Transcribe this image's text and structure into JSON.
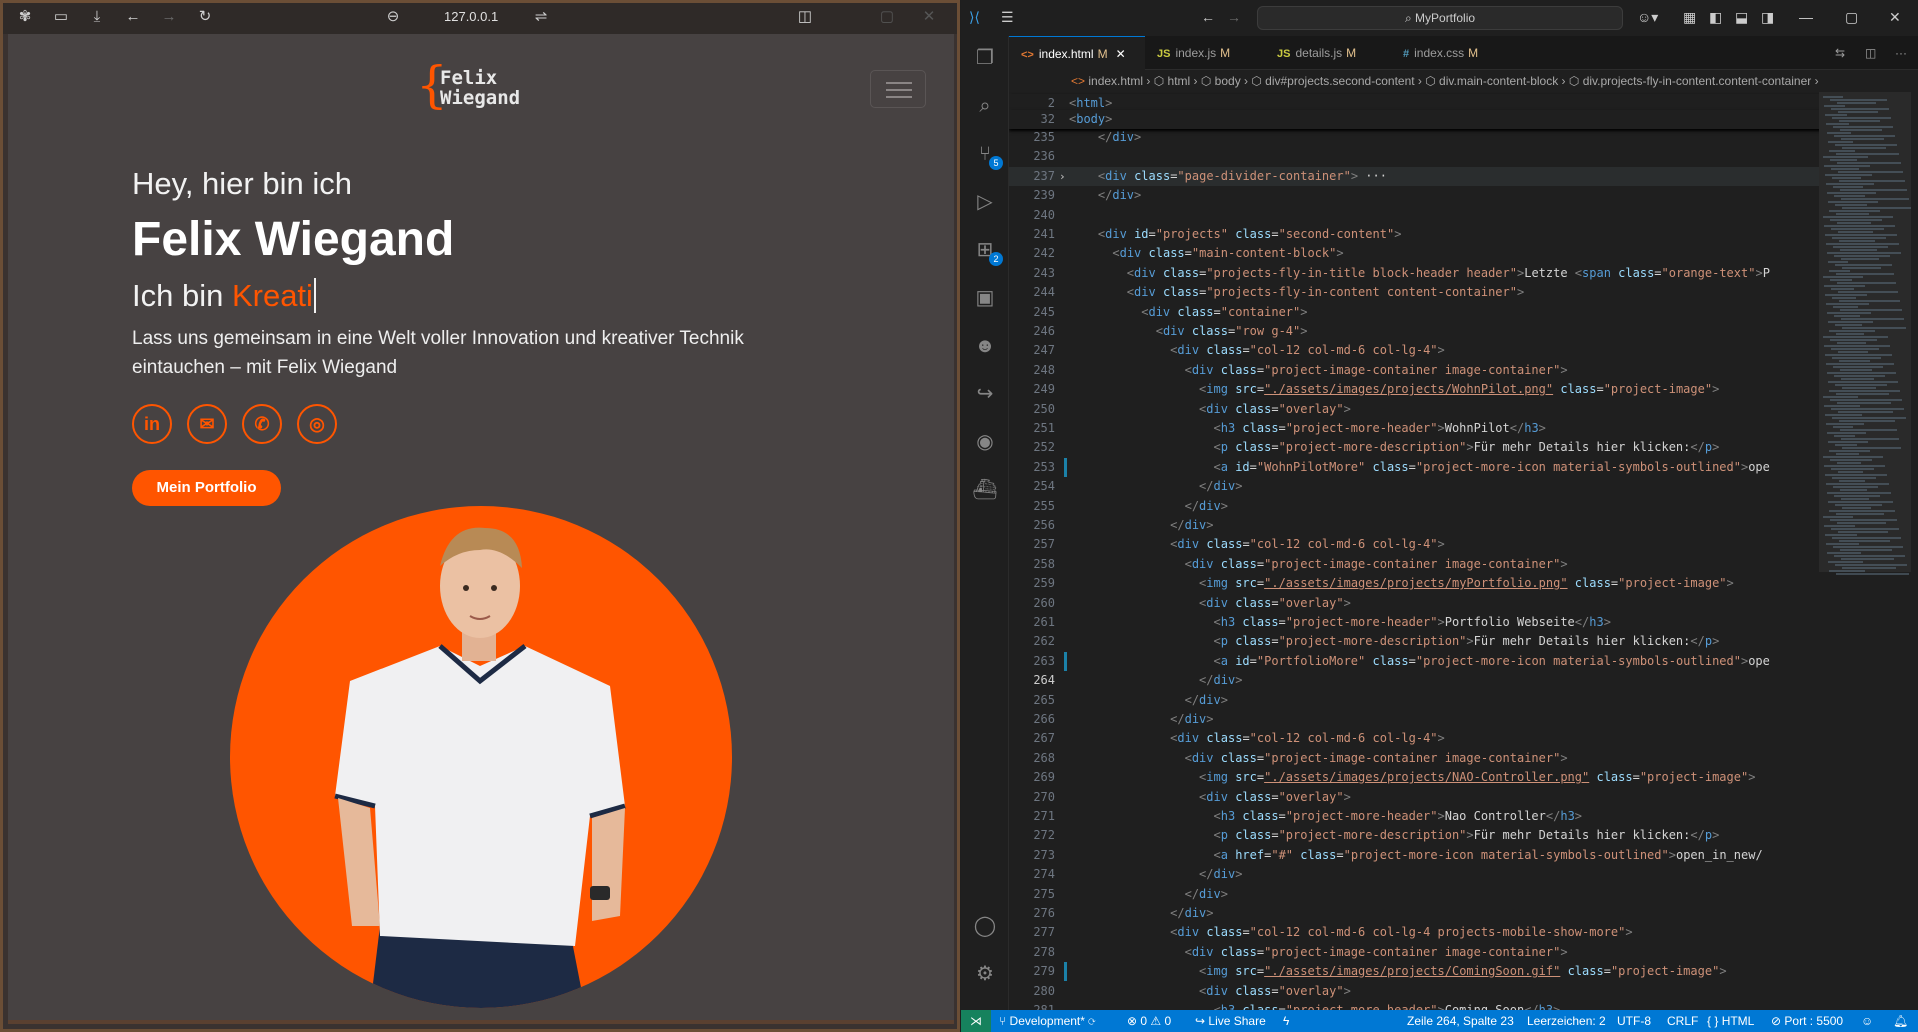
{
  "browser": {
    "url": "127.0.0.1",
    "toolbar_icons": [
      "extensions-icon",
      "sidebar-icon",
      "download-icon",
      "back-icon",
      "forward-icon",
      "reload-icon",
      "secure-icon",
      "settings-icon",
      "split-icon"
    ],
    "page": {
      "logo_brace": "{",
      "logo_line1": "Felix",
      "logo_line2": "Wiegand",
      "hero_greeting": "Hey, hier bin ich",
      "hero_name": "Felix Wiegand",
      "hero_role_prefix": "Ich bin ",
      "hero_role_typed": "Kreati",
      "hero_description": "Lass uns gemeinsam in eine Welt voller Innovation und kreativer Technik eintauchen – mit Felix Wiegand",
      "socials": [
        {
          "name": "linkedin-icon",
          "glyph": "in"
        },
        {
          "name": "mail-icon",
          "glyph": "✉"
        },
        {
          "name": "phone-icon",
          "glyph": "✆"
        },
        {
          "name": "instagram-icon",
          "glyph": "◎"
        }
      ],
      "cta_label": "Mein Portfolio",
      "accent_color": "#ff5500",
      "background_color": "#474242"
    }
  },
  "vscode": {
    "command_center": "MyPortfolio",
    "tabs": [
      {
        "label": "index.html",
        "icon": "<>",
        "mod": "M",
        "active": true
      },
      {
        "label": "index.js",
        "icon": "JS",
        "mod": "M",
        "active": false
      },
      {
        "label": "details.js",
        "icon": "JS",
        "mod": "M",
        "active": false
      },
      {
        "label": "index.css",
        "icon": "#",
        "mod": "M",
        "active": false
      }
    ],
    "breadcrumb": "index.html  ›  ⬡ html  ›  ⬡ body  ›  ⬡ div#projects.second-content  ›  ⬡ div.main-content-block  ›  ⬡ div.projects-fly-in-content.content-container  ›",
    "activity_badges": {
      "source_control": "5",
      "extensions": "2"
    },
    "sticky_lines": [
      {
        "n": "2",
        "code": "<html>"
      },
      {
        "n": "32",
        "code": "<body>"
      }
    ],
    "lines": [
      {
        "n": "235",
        "code": "    </div>"
      },
      {
        "n": "236",
        "code": ""
      },
      {
        "n": "237",
        "code": "    <div class=\"page-divider-container\"> ···"
      },
      {
        "n": "239",
        "code": "    </div>"
      },
      {
        "n": "240",
        "code": ""
      },
      {
        "n": "241",
        "code": "    <div id=\"projects\" class=\"second-content\">"
      },
      {
        "n": "242",
        "code": "      <div class=\"main-content-block\">"
      },
      {
        "n": "243",
        "code": "        <div class=\"projects-fly-in-title block-header header\">Letzte <span class=\"orange-text\">P"
      },
      {
        "n": "244",
        "code": "        <div class=\"projects-fly-in-content content-container\">"
      },
      {
        "n": "245",
        "code": "          <div class=\"container\">"
      },
      {
        "n": "246",
        "code": "            <div class=\"row g-4\">"
      },
      {
        "n": "247",
        "code": "              <div class=\"col-12 col-md-6 col-lg-4\">"
      },
      {
        "n": "248",
        "code": "                <div class=\"project-image-container image-container\">"
      },
      {
        "n": "249",
        "code": "                  <img src=\"./assets/images/projects/WohnPilot.png\" class=\"project-image\">"
      },
      {
        "n": "250",
        "code": "                  <div class=\"overlay\">"
      },
      {
        "n": "251",
        "code": "                    <h3 class=\"project-more-header\">WohnPilot</h3>"
      },
      {
        "n": "252",
        "code": "                    <p class=\"project-more-description\">Für mehr Details hier klicken:</p>"
      },
      {
        "n": "253",
        "code": "                    <a id=\"WohnPilotMore\" class=\"project-more-icon material-symbols-outlined\">ope"
      },
      {
        "n": "254",
        "code": "                  </div>"
      },
      {
        "n": "255",
        "code": "                </div>"
      },
      {
        "n": "256",
        "code": "              </div>"
      },
      {
        "n": "257",
        "code": "              <div class=\"col-12 col-md-6 col-lg-4\">"
      },
      {
        "n": "258",
        "code": "                <div class=\"project-image-container image-container\">"
      },
      {
        "n": "259",
        "code": "                  <img src=\"./assets/images/projects/myPortfolio.png\" class=\"project-image\">"
      },
      {
        "n": "260",
        "code": "                  <div class=\"overlay\">"
      },
      {
        "n": "261",
        "code": "                    <h3 class=\"project-more-header\">Portfolio Webseite</h3>"
      },
      {
        "n": "262",
        "code": "                    <p class=\"project-more-description\">Für mehr Details hier klicken:</p>"
      },
      {
        "n": "263",
        "code": "                    <a id=\"PortfolioMore\" class=\"project-more-icon material-symbols-outlined\">ope"
      },
      {
        "n": "264",
        "code": "                  </div>"
      },
      {
        "n": "265",
        "code": "                </div>"
      },
      {
        "n": "266",
        "code": "              </div>"
      },
      {
        "n": "267",
        "code": "              <div class=\"col-12 col-md-6 col-lg-4\">"
      },
      {
        "n": "268",
        "code": "                <div class=\"project-image-container image-container\">"
      },
      {
        "n": "269",
        "code": "                  <img src=\"./assets/images/projects/NAO-Controller.png\" class=\"project-image\">"
      },
      {
        "n": "270",
        "code": "                  <div class=\"overlay\">"
      },
      {
        "n": "271",
        "code": "                    <h3 class=\"project-more-header\">Nao Controller</h3>"
      },
      {
        "n": "272",
        "code": "                    <p class=\"project-more-description\">Für mehr Details hier klicken:</p>"
      },
      {
        "n": "273",
        "code": "                    <a href=\"#\" class=\"project-more-icon material-symbols-outlined\">open_in_new</"
      },
      {
        "n": "274",
        "code": "                  </div>"
      },
      {
        "n": "275",
        "code": "                </div>"
      },
      {
        "n": "276",
        "code": "              </div>"
      },
      {
        "n": "277",
        "code": "              <div class=\"col-12 col-md-6 col-lg-4 projects-mobile-show-more\">"
      },
      {
        "n": "278",
        "code": "                <div class=\"project-image-container image-container\">"
      },
      {
        "n": "279",
        "code": "                  <img src=\"./assets/images/projects/ComingSoon.gif\" class=\"project-image\">"
      },
      {
        "n": "280",
        "code": "                  <div class=\"overlay\">"
      },
      {
        "n": "281",
        "code": "                    <h3 class=\"project-more-header\">Coming Soon</h3>"
      }
    ],
    "current_line": "264",
    "statusbar": {
      "branch": "Development*",
      "problems": "⊗ 0 ⚠ 0",
      "live_share": "Live Share",
      "cursor": "Zeile 264, Spalte 23",
      "indent": "Leerzeichen: 2",
      "encoding": "UTF-8",
      "eol": "CRLF",
      "language": "HTML",
      "port": "Port : 5500"
    }
  }
}
